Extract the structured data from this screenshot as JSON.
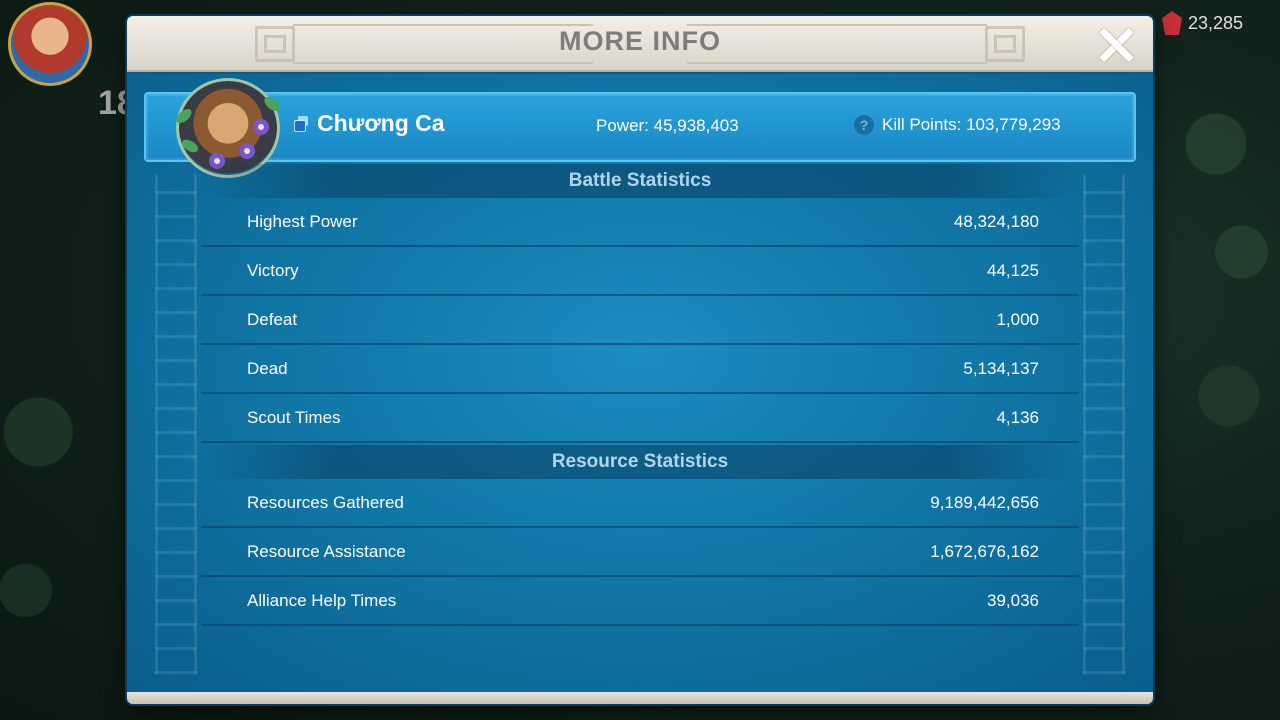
{
  "hud": {
    "level": "18",
    "gems": "23,285"
  },
  "dialog": {
    "title": "MORE INFO"
  },
  "player": {
    "name": "Chương Ca",
    "power": "Power: 45,938,403",
    "kill_points": "Kill Points: 103,779,293"
  },
  "battle": {
    "heading": "Battle Statistics",
    "rows": [
      {
        "label": "Highest Power",
        "value": "48,324,180"
      },
      {
        "label": "Victory",
        "value": "44,125"
      },
      {
        "label": "Defeat",
        "value": "1,000"
      },
      {
        "label": "Dead",
        "value": "5,134,137"
      },
      {
        "label": "Scout Times",
        "value": "4,136"
      }
    ]
  },
  "resource": {
    "heading": "Resource Statistics",
    "rows": [
      {
        "label": "Resources Gathered",
        "value": "9,189,442,656"
      },
      {
        "label": "Resource Assistance",
        "value": "1,672,676,162"
      },
      {
        "label": "Alliance Help Times",
        "value": "39,036"
      }
    ]
  },
  "colors": {
    "panel": "#117aaa",
    "header_card": "#2aa3dd",
    "section_text": "#aed6ee"
  }
}
